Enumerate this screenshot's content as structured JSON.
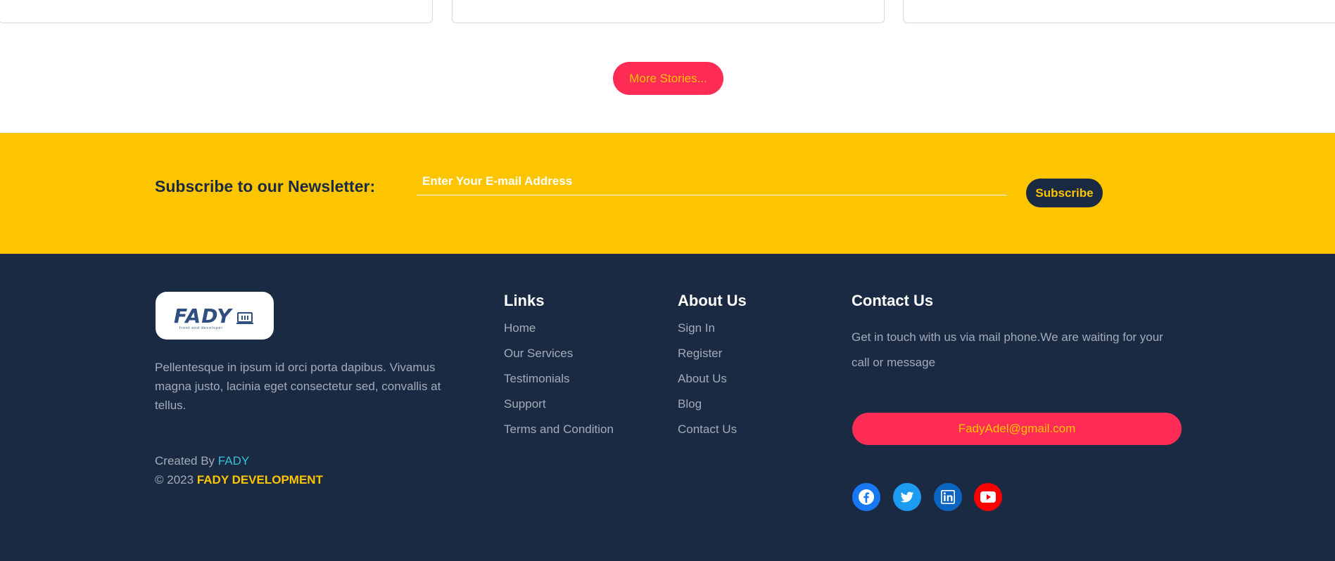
{
  "more_stories": {
    "label": "More Stories..."
  },
  "newsletter": {
    "title": "Subscribe to our Newsletter:",
    "email_placeholder": "Enter Your E-mail Address",
    "subscribe_label": "Subscribe"
  },
  "footer": {
    "logo": {
      "text": "FADY",
      "subtitle": "front end developer"
    },
    "about_text": "Pellentesque in ipsum id orci porta dapibus. Vivamus magna justo, lacinia eget consectetur sed, convallis at tellus.",
    "created_prefix": "Created By",
    "created_name": "FADY",
    "copyright_prefix": "© 2023",
    "copyright_name": "FADY DEVELOPMENT",
    "links": {
      "title": "Links",
      "items": [
        "Home",
        "Our Services",
        "Testimonials",
        "Support",
        "Terms and Condition"
      ]
    },
    "about_us": {
      "title": "About Us",
      "items": [
        "Sign In",
        "Register",
        "About Us",
        "Blog",
        "Contact Us"
      ]
    },
    "contact": {
      "title": "Contact Us",
      "text": "Get in touch with us via mail phone.We are waiting for your call or message",
      "email": "FadyAdel@gmail.com"
    },
    "social": [
      {
        "name": "facebook-icon",
        "color": "#1877f2"
      },
      {
        "name": "twitter-icon",
        "color": "#1d9bf0"
      },
      {
        "name": "linkedin-icon",
        "color": "#0a66c2"
      },
      {
        "name": "youtube-icon",
        "color": "#ff0000"
      }
    ]
  },
  "colors": {
    "accent_red": "#ff2d55",
    "accent_yellow": "#fdc500",
    "footer_bg": "#1b2a43",
    "teal": "#34c3d6"
  }
}
